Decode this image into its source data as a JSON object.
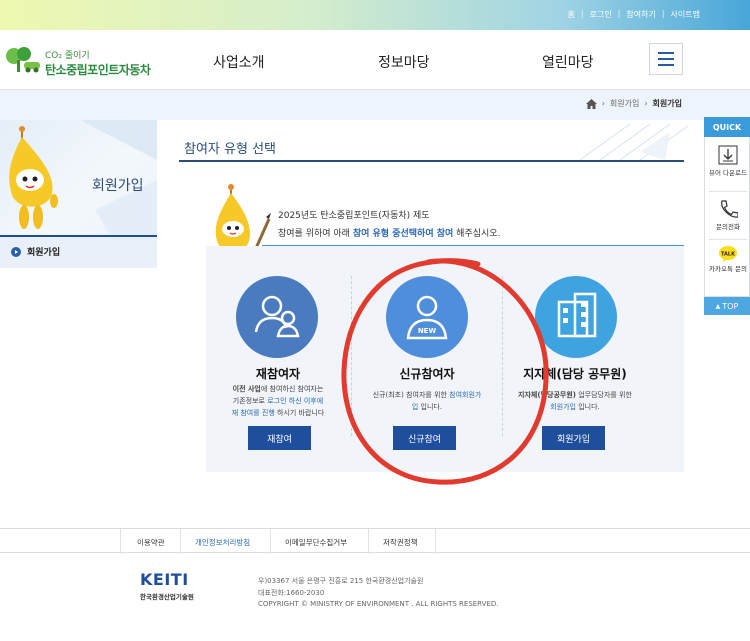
{
  "top_links": [
    "홈",
    "로그인",
    "참여하기",
    "사이트맵"
  ],
  "logo": {
    "sub": "CO₂ 줄이기",
    "main": "탄소중립포인트자동차"
  },
  "nav": [
    "사업소개",
    "정보마당",
    "열린마당"
  ],
  "breadcrumb": {
    "item1": "회원가입",
    "item2": "회원가입"
  },
  "sidebar": {
    "title": "회원가입",
    "menu_item": "회원가입"
  },
  "content": {
    "title": "참여자 유형 선택",
    "intro_line1": "2025년도 탄소중립포인트(자동차) 제도",
    "intro_line2_a": "참여를 위하여 아래 ",
    "intro_line2_b": "참여 유형 중선택하여 참여",
    "intro_line2_c": " 해주십시오."
  },
  "cards": [
    {
      "title": "재참여자",
      "desc1a": "이전 사업",
      "desc1b": "에",
      "desc1c": " 참여하신 참여자는",
      "desc2a": "기존정보로 ",
      "desc2b": "로그인 하신 이후에",
      "desc3a": "재 참여를 진행",
      "desc3b": " 하시기 바랍니다",
      "button": "재참여"
    },
    {
      "title": "신규참여자",
      "badge": "NEW",
      "desc1a": "신규(최초)",
      "desc1b": " 참여자를 위한 ",
      "desc1c": "참여회원가",
      "desc2a": "입",
      "desc2b": " 입니다.",
      "button": "신규참여"
    },
    {
      "title": "지자체(담당 공무원)",
      "desc1a": "지자체(담당공무원)",
      "desc1b": " 업무담당자를 위한",
      "desc2a": "회원가입",
      "desc2b": " 입니다.",
      "button": "회원가입"
    }
  ],
  "quick": {
    "head": "QUICK",
    "items": [
      "뷰어 다운로드",
      "문의전화",
      "카카오톡 문의"
    ],
    "top": "TOP"
  },
  "footer": {
    "links": [
      "이용약관",
      "개인정보처리방침",
      "이메일무단수집거부",
      "저작권정책"
    ],
    "logo_en": "KEITI",
    "logo_ko": "한국환경산업기술원",
    "addr": "우)03367 서울 은평구 진흥로 215 한국환경산업기술원",
    "tel": "대표전화:1660-2030",
    "copyright": "COPYRIGHT © MINISTRY OF ENVIRONMENT . ALL RIGHTS RESERVED."
  },
  "colors": {
    "primary": "#1f4e9c",
    "accent": "#2a68b5",
    "circle_gray": "#4a7bbf",
    "circle_new": "#4e8edb",
    "circle_gov": "#3fa3e0",
    "annotation": "#e03b2e"
  }
}
